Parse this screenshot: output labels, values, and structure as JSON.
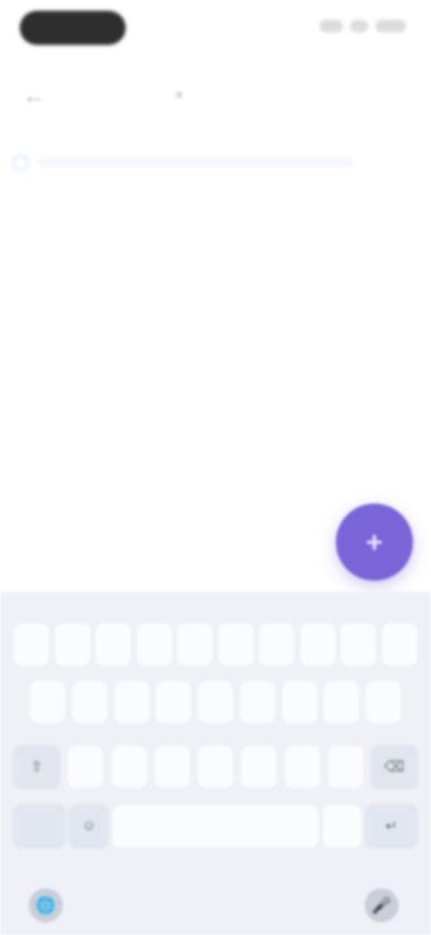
{
  "status_bar": {},
  "app_bar": {
    "back_icon": "←",
    "title": "",
    "title_chevron": "▾"
  },
  "search": {
    "icon": "search-icon",
    "placeholder": ""
  },
  "fab": {
    "icon": "+",
    "accent": "#7a64d8"
  },
  "keyboard": {
    "row1": [
      "",
      "",
      "",
      "",
      "",
      "",
      "",
      "",
      "",
      ""
    ],
    "row2": [
      "",
      "",
      "",
      "",
      "",
      "",
      "",
      "",
      ""
    ],
    "row3": [
      "⇧",
      "",
      "",
      "",
      "",
      "",
      "",
      "",
      "⌫"
    ],
    "row4": {
      "k123": "",
      "emoji": "☺",
      "space": "",
      "period": "",
      "enter": "↵"
    },
    "globe_icon": "🌐",
    "mic_icon": "🎤"
  }
}
